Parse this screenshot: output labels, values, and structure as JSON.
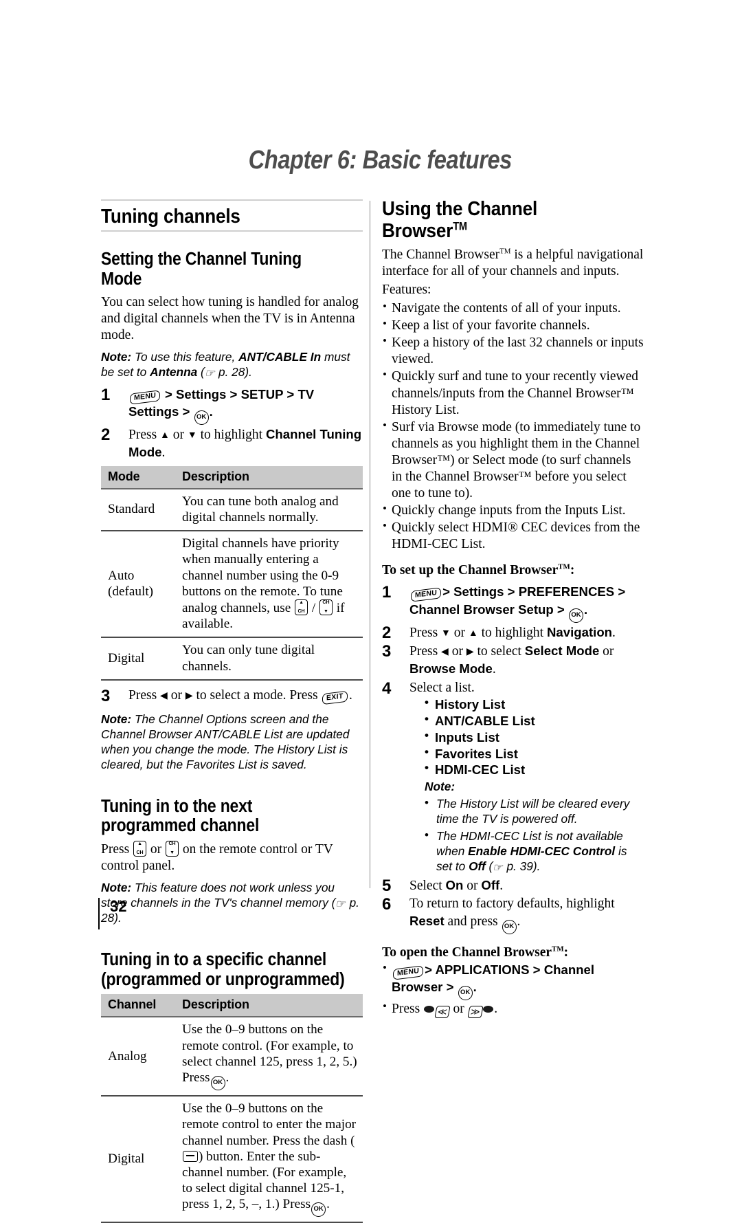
{
  "chapter": {
    "title": "Chapter 6: Basic features"
  },
  "left_column": {
    "section_title": "Tuning channels",
    "sub1": {
      "heading": "Setting the Channel Tuning Mode",
      "intro": "You can select how tuning is handled for analog and digital channels when the TV is in Antenna mode.",
      "note_label": "Note:",
      "note_pre": "To use this feature,",
      "note_bold1": "ANT/CABLE In",
      "note_mid": "must be set to",
      "note_bold2": "Antenna",
      "note_ref": "p. 28).",
      "note_paren_open": "(",
      "steps": [
        {
          "num": "1",
          "seg_menu": "MENU",
          "seg_a": "> ",
          "seg_settings": "Settings",
          "seg_b": " > ",
          "seg_setup": "SETUP",
          "seg_c": " > ",
          "seg_tv": "TV Settings",
          "seg_d": " > ",
          "seg_ok": "OK",
          "seg_end": "."
        },
        {
          "num": "2",
          "text_pre": "Press ",
          "arrow_up": "▲",
          "text_or": " or ",
          "arrow_down": "▼",
          "text_mid": " to highlight ",
          "bold": "Channel Tuning Mode",
          "text_end": "."
        },
        {
          "num": "3",
          "text_pre": "Press ",
          "arrow_left": "◀",
          "text_or": " or ",
          "arrow_right": "▶",
          "text_mid": " to select a mode. Press ",
          "key": "EXIT",
          "text_end": "."
        }
      ],
      "table": {
        "headers": [
          "Mode",
          "Description"
        ],
        "rows": [
          {
            "mode": "Standard",
            "desc": "You can tune both analog and digital channels normally."
          },
          {
            "mode": "Auto (default)",
            "mode_line1": "Auto",
            "mode_line2": "(default)",
            "desc_part1": "Digital channels have priority when manually entering a channel number using the 0-9 buttons on the remote. To tune analog channels, use",
            "desc_part2": "if available.",
            "desc_slash": "/"
          },
          {
            "mode": "Digital",
            "desc": "You can only tune digital channels."
          }
        ]
      },
      "note2_label": "Note:",
      "note2": "The Channel Options screen and the Channel Browser ANT/CABLE List are updated when you change the mode. The History List is cleared, but the Favorites List is saved."
    },
    "sub2": {
      "heading": "Tuning in to the next programmed channel",
      "body_pre": "Press ",
      "body_or": " or ",
      "body_post": " on the remote control or TV control panel.",
      "note_label": "Note:",
      "note_pre": "This feature does not work unless you store channels in the TV's channel memory (",
      "note_ref": "p. 28)."
    },
    "sub3": {
      "heading_line1": "Tuning in to a specific channel",
      "heading_line2": "(programmed or unprogrammed)",
      "table": {
        "headers": [
          "Channel",
          "Description"
        ],
        "rows": [
          {
            "channel": "Analog",
            "desc_pre": "Use the 0–9 buttons on the remote control. (For example, to select channel 125, press 1, 2, 5.) Press",
            "desc_post": "."
          },
          {
            "channel": "Digital",
            "desc_pre": "Use the 0–9 buttons on the remote control to enter the major channel number. Press the dash (",
            "desc_mid": ") button. Enter the sub-channel number. (For example, to select digital channel 125-1, press 1, 2, 5, –, 1.) Press",
            "desc_post": "."
          }
        ]
      }
    }
  },
  "right_column": {
    "heading": "Using the Channel Browser",
    "heading_tm": "TM",
    "intro": "The Channel Browser",
    "intro_tm": "TM",
    "intro_cont": " is a helpful navigational interface for all of your channels and inputs.",
    "features_label": "Features:",
    "features": [
      "Navigate the contents of all of your inputs.",
      "Keep a list of your favorite channels.",
      "Keep a history of the last 32 channels or inputs viewed.",
      "Quickly surf and tune to your recently viewed channels/inputs from the Channel Browser™ History List.",
      "Surf via Browse mode (to immediately tune to channels as you highlight them in the Channel Browser™) or Select mode (to surf channels in the Channel Browser™ before you select one to tune to).",
      "Quickly change inputs from the Inputs List.",
      "Quickly select HDMI® CEC devices from the HDMI-CEC List."
    ],
    "setup_label": "To set up the Channel Browser",
    "setup_label_tm": "TM",
    "setup_label_colon": ":",
    "steps": [
      {
        "num": "1",
        "seg_menu": "MENU",
        "seg_a": "> ",
        "seg_settings": "Settings",
        "seg_b": " > ",
        "seg_pref": "PREFERENCES",
        "seg_c": " > ",
        "seg_cbs": "Channel Browser Setup",
        "seg_d": " > ",
        "seg_ok": "OK",
        "seg_end": "."
      },
      {
        "num": "2",
        "text_pre": "Press ",
        "arrow_down": "▼",
        "text_or": " or ",
        "arrow_up": "▲",
        "text_mid": " to highlight ",
        "bold": "Navigation",
        "text_end": "."
      },
      {
        "num": "3",
        "text_pre": "Press ",
        "arrow_left": "◀",
        "text_or": " or ",
        "arrow_right": "▶",
        "text_mid": " to select ",
        "bold1": "Select Mode",
        "text_or2": " or ",
        "bold2": "Browse Mode",
        "text_end": "."
      },
      {
        "num": "4",
        "text": "Select a list."
      }
    ],
    "list_options": [
      "History List",
      "ANT/CABLE List",
      "Inputs List",
      "Favorites List",
      "HDMI-CEC List"
    ],
    "note_label": "Note:",
    "notes": [
      {
        "text": "The History List will be cleared every time the TV is powered off."
      },
      {
        "pre": "The HDMI-CEC List is not available when ",
        "bold1": "Enable HDMI-CEC Control",
        "mid": " is set to ",
        "bold2": "Off",
        "ref": "p. 39)."
      }
    ],
    "steps2": [
      {
        "num": "5",
        "text_pre": "Select ",
        "bold1": "On",
        "text_or": " or ",
        "bold2": "Off",
        "text_end": "."
      },
      {
        "num": "6",
        "text_pre": "To return to factory defaults, highlight ",
        "bold1": "Reset",
        "text_mid": " and press ",
        "seg_ok": "OK",
        "text_end": "."
      }
    ],
    "open_label": "To open the Channel Browser",
    "open_label_tm": "TM",
    "open_label_colon": ":",
    "open_bullets": [
      {
        "key": "MENU",
        "seg_a": "> ",
        "seg_apps": "APPLICATIONS",
        "seg_b": " > ",
        "seg_cb": "Channel Browser",
        "seg_c": " > ",
        "seg_ok": "OK",
        "seg_end": "."
      },
      {
        "text_pre": "Press ",
        "text_or": " or ",
        "text_end": "."
      }
    ]
  },
  "footer": {
    "page_number": "32"
  },
  "colors": {
    "chapter_title": "#4d4d4d",
    "table_header_bg": "#c9c9c9",
    "rule_light": "#cfcfcf",
    "rule_dark": "#4a4a4a",
    "divider": "#8a8a8a"
  }
}
